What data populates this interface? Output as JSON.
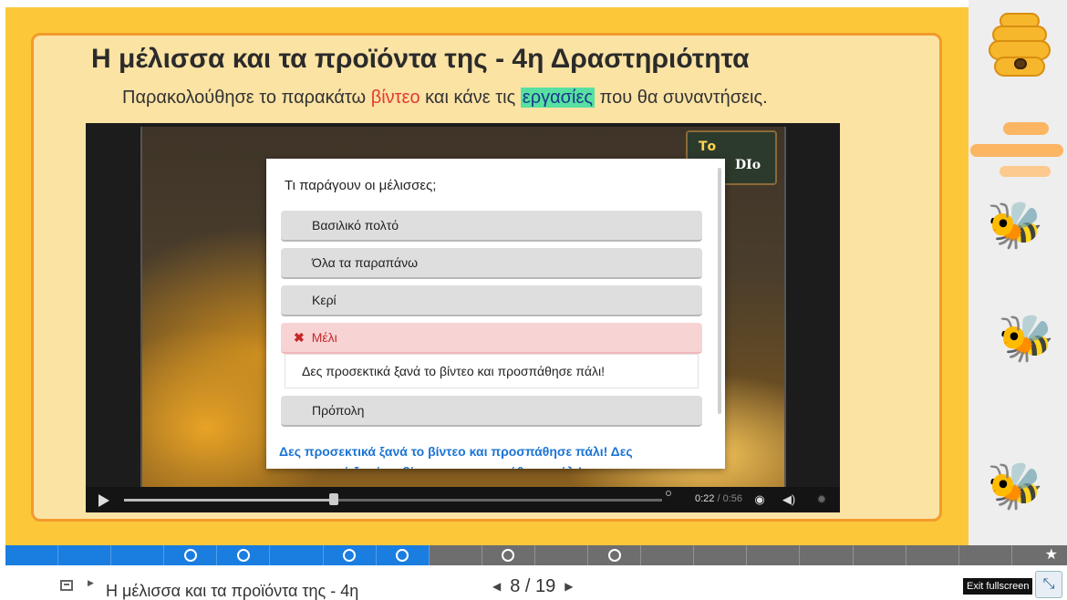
{
  "slide": {
    "title": "Η μέλισσα και τα προϊόντα της - 4η Δραστηριότητα",
    "subtitle_pre": "Παρακολούθησε το παρακάτω ",
    "subtitle_red": "βίντεο",
    "subtitle_mid": " και κάνε τις ",
    "subtitle_hl": "εργασίες",
    "subtitle_post": " που θα συναντήσεις."
  },
  "video": {
    "logo_text1": "Το",
    "logo_text2": "DIo",
    "time_current": "0:22",
    "time_duration": "/ 0:56",
    "progress_fraction": 0.39,
    "icons": [
      "play-icon",
      "settings-gauge-icon",
      "volume-icon",
      "gear-icon"
    ]
  },
  "quiz": {
    "question": "Τι παράγουν οι μέλισσες;",
    "answers": [
      {
        "label": "Βασιλικό πολτό",
        "state": "default"
      },
      {
        "label": "Όλα τα παραπάνω",
        "state": "default"
      },
      {
        "label": "Κερί",
        "state": "default"
      },
      {
        "label": "Μέλι",
        "state": "wrong",
        "mark": "✖"
      },
      {
        "label": "Πρόπολη",
        "state": "default"
      }
    ],
    "feedback": "Δες προσεκτικά ξανά το βίντεο και προσπάθησε πάλι!",
    "overall_feedback": "Δες προσεκτικά ξανά το βίντεο και προσπάθησε πάλι! Δες προσεκτικά ξανά το βίντεο και προσπάθησε πάλι!"
  },
  "progress": {
    "segments_total": 19,
    "segments_done": 8,
    "current_slide": 8,
    "circle_markers": [
      4,
      5,
      7,
      8,
      10,
      12
    ],
    "end_icon": "★"
  },
  "bottom_nav": {
    "slide_title": "Η μέλισσα και τα προϊόντα της - 4η",
    "current": "8",
    "separator": "/",
    "total": "19",
    "prev_arrow": "◀",
    "next_arrow": "▶",
    "tooltip": "Exit fullscreen",
    "exit_icon": "⤡"
  },
  "colors": {
    "slide_bg": "#fcc83a",
    "frame_bg": "#fbe3a4",
    "frame_border": "#f39a2c",
    "progress_done": "#1a7de0",
    "progress_todo": "#6e6e6e",
    "feedback_text": "#1b74d4",
    "wrong_bg": "#f8d3d4"
  }
}
